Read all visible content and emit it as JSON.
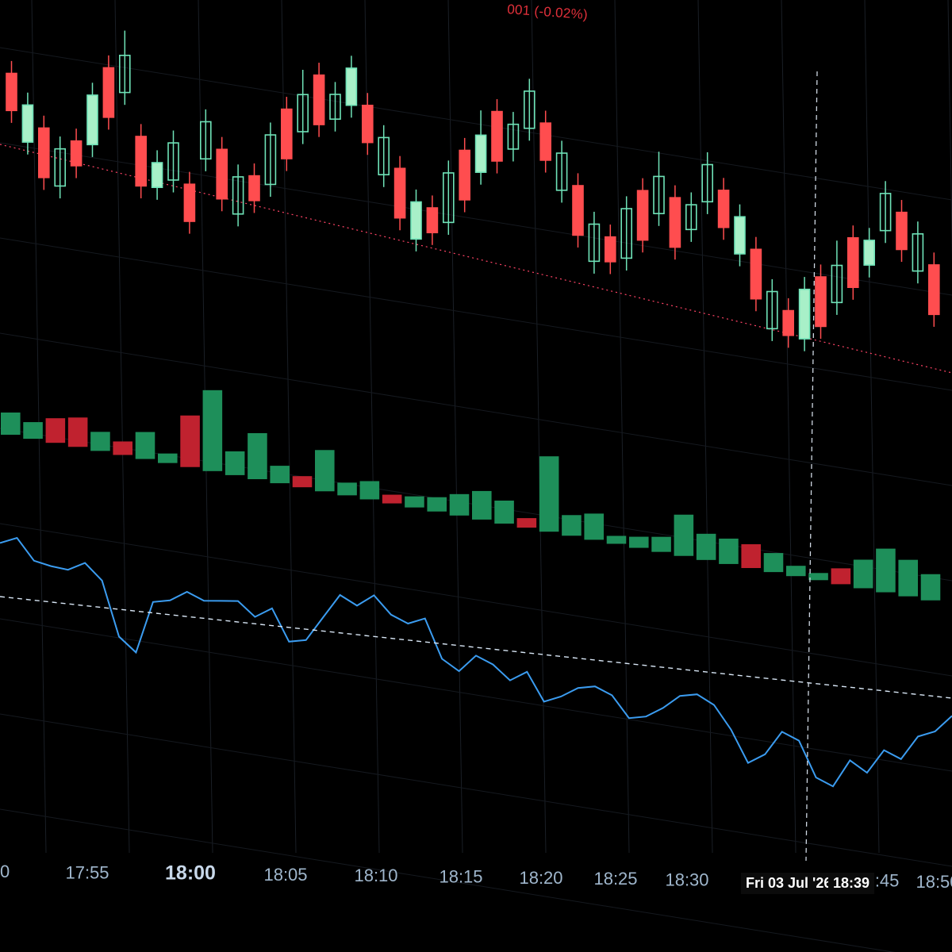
{
  "header": {
    "price_change_text": "001 (-0.02%)"
  },
  "colors": {
    "background": "#000000",
    "up_fill": "#a8f0c8",
    "up_stroke": "#6fe3b8",
    "down": "#ff4d4f",
    "volume_up": "#1e8f5a",
    "volume_down": "#c0222f",
    "indicator_line": "#3b9cf0",
    "crosshair": "#cfd8e3",
    "last_price_line": "#ff4466",
    "axis_text": "#9fb6cc"
  },
  "x_axis": {
    "ticks": [
      "0",
      "17:55",
      "18:00",
      "18:05",
      "18:10",
      "18:15",
      "18:20",
      "18:25",
      "18:30",
      "3:45",
      "18:50"
    ],
    "bold_tick": "18:00"
  },
  "crosshair": {
    "date_label": "Fri 03 Jul '26",
    "time_label": "18:39"
  },
  "chart_data": [
    {
      "type": "candlestick",
      "title": "",
      "candles": [
        {
          "o": 5,
          "c": 2,
          "h": 6,
          "l": 1
        },
        {
          "o": 2,
          "c": 5,
          "h": 6,
          "l": 1
        },
        {
          "o": 5,
          "c": 1,
          "h": 6,
          "l": 0
        },
        {
          "o": 1,
          "c": 4,
          "h": 5,
          "l": 0
        },
        {
          "o": 4,
          "c": 2,
          "h": 5,
          "l": 1
        },
        {
          "o": 2,
          "c": 6,
          "h": 7,
          "l": 1
        },
        {
          "o": 6,
          "c": 2,
          "h": 7,
          "l": 1
        },
        {
          "o": 2,
          "c": 5,
          "h": 7,
          "l": 1
        },
        {
          "o": 5,
          "c": 1,
          "h": 6,
          "l": 0
        },
        {
          "o": 1,
          "c": 3,
          "h": 4,
          "l": 0
        },
        {
          "o": 3,
          "c": 6,
          "h": 7,
          "l": 2
        }
      ]
    },
    {
      "type": "bar",
      "title": "",
      "values": [
        28,
        21,
        31,
        37,
        24,
        17,
        34,
        12,
        65,
        102,
        30,
        58,
        22,
        14,
        52,
        16,
        23,
        11,
        14,
        18,
        27,
        36,
        29,
        12,
        95,
        26,
        33,
        10,
        14,
        19,
        52,
        33,
        32,
        30,
        24,
        13,
        9,
        20,
        36,
        55,
        46,
        33
      ]
    },
    {
      "type": "line",
      "title": "",
      "values": [
        48,
        52,
        40,
        38,
        37,
        42,
        33,
        2,
        -6,
        24,
        26,
        32,
        28,
        29,
        30,
        22,
        28,
        10,
        12,
        26,
        40,
        35,
        42,
        32,
        28,
        32,
        10,
        4,
        14,
        10,
        2,
        8,
        -8,
        -4,
        2,
        4,
        0,
        -12,
        -10,
        -4,
        4,
        6,
        1,
        -12,
        -30,
        -24,
        -10,
        -14,
        -34,
        -38,
        -22,
        -28,
        -14,
        -18,
        -4,
        0,
        10
      ]
    }
  ]
}
